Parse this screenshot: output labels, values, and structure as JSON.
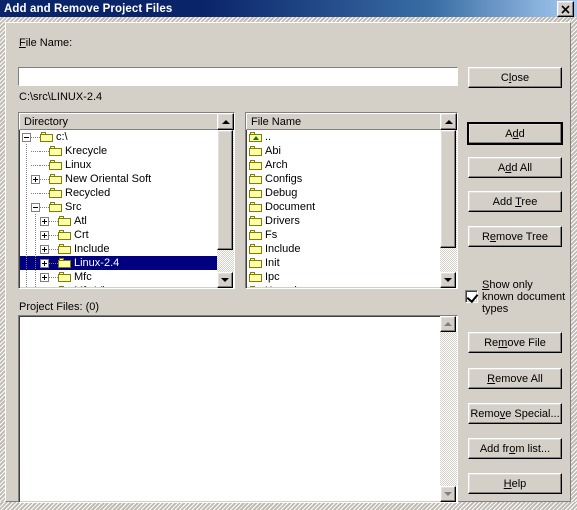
{
  "window": {
    "title": "Add and Remove Project Files",
    "close_button": "✖"
  },
  "form": {
    "file_name_label": "File Name:",
    "file_name_value": "",
    "file_name_placeholder": "",
    "current_path": "C:\\src\\LINUX-2.4"
  },
  "directory_panel": {
    "header": "Directory",
    "items": [
      {
        "label": "c:\\",
        "depth": 0,
        "toggle": "minus",
        "icon": "folder-icon",
        "selected": false
      },
      {
        "label": "Krecycle",
        "depth": 1,
        "toggle": "none",
        "icon": "folder-icon",
        "selected": false
      },
      {
        "label": "Linux",
        "depth": 1,
        "toggle": "none",
        "icon": "folder-icon",
        "selected": false
      },
      {
        "label": "New Oriental Soft",
        "depth": 1,
        "toggle": "plus",
        "icon": "folder-icon",
        "selected": false
      },
      {
        "label": "Recycled",
        "depth": 1,
        "toggle": "none",
        "icon": "folder-icon",
        "selected": false
      },
      {
        "label": "Src",
        "depth": 1,
        "toggle": "minus",
        "icon": "folder-icon",
        "selected": false
      },
      {
        "label": "Atl",
        "depth": 2,
        "toggle": "plus",
        "icon": "folder-icon",
        "selected": false
      },
      {
        "label": "Crt",
        "depth": 2,
        "toggle": "plus",
        "icon": "folder-icon",
        "selected": false
      },
      {
        "label": "Include",
        "depth": 2,
        "toggle": "plus",
        "icon": "folder-icon",
        "selected": false
      },
      {
        "label": "Linux-2.4",
        "depth": 2,
        "toggle": "plus",
        "icon": "folder-icon",
        "selected": true
      },
      {
        "label": "Mfc",
        "depth": 2,
        "toggle": "plus",
        "icon": "folder-icon",
        "selected": false
      },
      {
        "label": "Mfc Vb",
        "depth": 2,
        "toggle": "plus",
        "icon": "folder-icon",
        "selected": false
      }
    ],
    "scroll_up": "scroll-up-arrow",
    "scroll_down": "scroll-down-arrow"
  },
  "file_panel": {
    "header": "File Name",
    "items": [
      {
        "label": "..",
        "icon": "folder-up-icon"
      },
      {
        "label": "Abi",
        "icon": "folder-icon"
      },
      {
        "label": "Arch",
        "icon": "folder-icon"
      },
      {
        "label": "Configs",
        "icon": "folder-icon"
      },
      {
        "label": "Debug",
        "icon": "folder-icon"
      },
      {
        "label": "Document",
        "icon": "folder-icon"
      },
      {
        "label": "Drivers",
        "icon": "folder-icon"
      },
      {
        "label": "Fs",
        "icon": "folder-icon"
      },
      {
        "label": "Include",
        "icon": "folder-icon"
      },
      {
        "label": "Init",
        "icon": "folder-icon"
      },
      {
        "label": "Ipc",
        "icon": "folder-icon"
      },
      {
        "label": "Kernel",
        "icon": "folder-icon"
      }
    ]
  },
  "project_files": {
    "label": "Project Files: (0)",
    "items": []
  },
  "buttons": {
    "close": {
      "pre": "C",
      "accel": "l",
      "post": "ose"
    },
    "add": {
      "pre": "A",
      "accel": "d",
      "post": "d"
    },
    "add_all": {
      "pre": "A",
      "accel": "d",
      "post": "d All"
    },
    "add_tree": {
      "pre": "Add ",
      "accel": "T",
      "post": "ree"
    },
    "remove_tree": {
      "pre": "R",
      "accel": "e",
      "post": "move Tree"
    },
    "remove_file": {
      "pre": "Re",
      "accel": "m",
      "post": "ove File"
    },
    "remove_all": {
      "pre": "",
      "accel": "R",
      "post": "emove All"
    },
    "remove_special": {
      "pre": "Remo",
      "accel": "v",
      "post": "e Special..."
    },
    "add_from_list": {
      "pre": "Add fr",
      "accel": "o",
      "post": "m list..."
    },
    "help": {
      "pre": "",
      "accel": "H",
      "post": "elp"
    }
  },
  "checkbox": {
    "checked": true,
    "line1_pre": "",
    "line1_accel": "S",
    "line1_post": "how only",
    "line2": "known document",
    "line3": "types"
  },
  "colors": {
    "face": "#d4d0c8",
    "title_start": "#0a246a",
    "title_end": "#a6caf0",
    "selection": "#000080",
    "folder_fill": "#ffffaa",
    "folder_outline": "#808000"
  }
}
